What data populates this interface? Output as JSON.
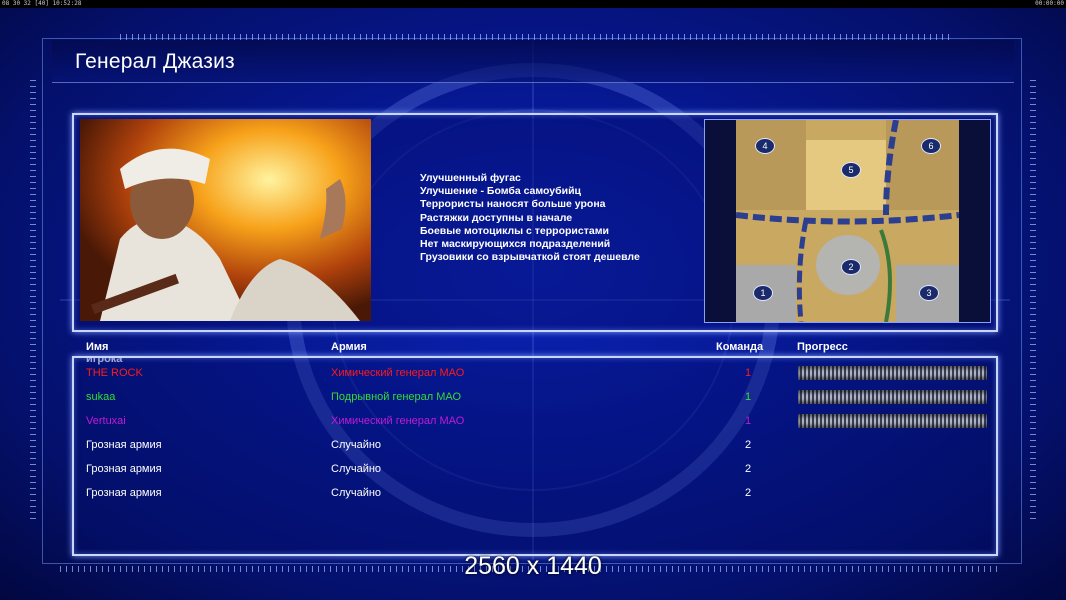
{
  "status_bar": {
    "left": "08 30 32 [40] 10:52:28",
    "right": "00:00:00"
  },
  "general": {
    "title": "Генерал Джазиз",
    "bonuses": [
      "Улучшенный фугас",
      "Улучшение - Бомба самоубийц",
      "Террористы наносят больше урона",
      "Растяжки доступны в начале",
      "Боевые мотоциклы с террористами",
      "Нет маскирующихся подразделений",
      "Грузовики со взрывчаткой стоят дешевле"
    ]
  },
  "map": {
    "slots": [
      "1",
      "2",
      "3",
      "4",
      "5",
      "6"
    ]
  },
  "table": {
    "headers": {
      "player": "Имя игрока",
      "army": "Армия",
      "team": "Команда",
      "progress": "Прогресс"
    },
    "rows": [
      {
        "player": "THE ROCK",
        "army": "Химический генерал МАО",
        "team": "1",
        "color": "#ff1a1a",
        "progress": 1.0
      },
      {
        "player": "sukaa",
        "army": "Подрывной генерал МАО",
        "team": "1",
        "color": "#33dd33",
        "progress": 1.0
      },
      {
        "player": "Vertuxai",
        "army": "Химический генерал МАО",
        "team": "1",
        "color": "#c21ad6",
        "progress": 1.0
      },
      {
        "player": "Грозная армия",
        "army": "Случайно",
        "team": "2",
        "color": "#ffffff",
        "progress": null
      },
      {
        "player": "Грозная армия",
        "army": "Случайно",
        "team": "2",
        "color": "#ffffff",
        "progress": null
      },
      {
        "player": "Грозная армия",
        "army": "Случайно",
        "team": "2",
        "color": "#ffffff",
        "progress": null
      }
    ]
  },
  "resolution_label": "2560 x 1440"
}
